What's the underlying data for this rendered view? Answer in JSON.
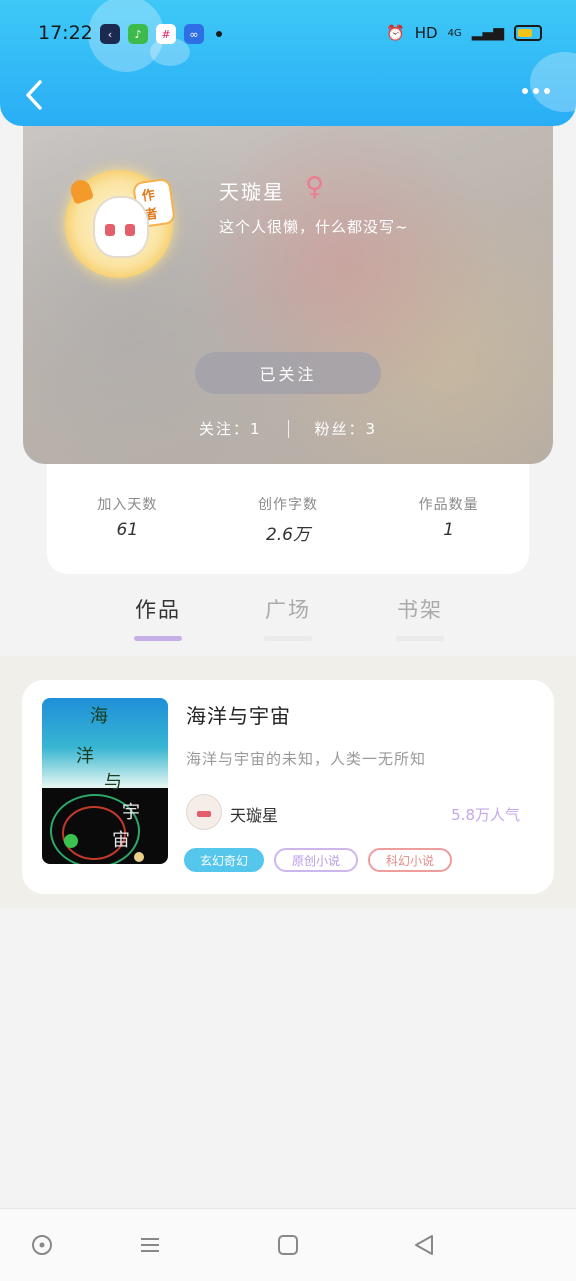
{
  "status_bar": {
    "time": "17:22",
    "hd": "HD",
    "network": "4G",
    "app_icons": [
      "kuaishou-icon",
      "wechat-icon",
      "slack-icon",
      "infinity-icon"
    ]
  },
  "header": {
    "back_icon": "chevron-left-icon",
    "more_icon": "more-dots-icon"
  },
  "profile": {
    "name": "天璇星",
    "gender_symbol": "♀",
    "bio": "这个人很懒，什么都没写~",
    "author_badge": "作者",
    "follow_button": "已关注",
    "following": "关注：1",
    "fans": "粉丝：3"
  },
  "stats": [
    {
      "label": "加入天数",
      "value": "61"
    },
    {
      "label": "创作字数",
      "value": "2.6万"
    },
    {
      "label": "作品数量",
      "value": "1"
    }
  ],
  "tabs": [
    {
      "label": "作品",
      "active": true
    },
    {
      "label": "广场",
      "active": false
    },
    {
      "label": "书架",
      "active": false
    }
  ],
  "book": {
    "title": "海洋与宇宙",
    "description": "海洋与宇宙的未知，人类一无所知",
    "author": "天璇星",
    "popularity": "5.8万人气",
    "tags": [
      "玄幻奇幻",
      "原创小说",
      "科幻小说"
    ],
    "cover_chars": [
      "海",
      "洋",
      "与",
      "宇",
      "宙"
    ]
  },
  "colors": {
    "header_blue": "#29aef5",
    "accent_purple": "#c6aee6",
    "tag_blue": "#56c7ec"
  }
}
